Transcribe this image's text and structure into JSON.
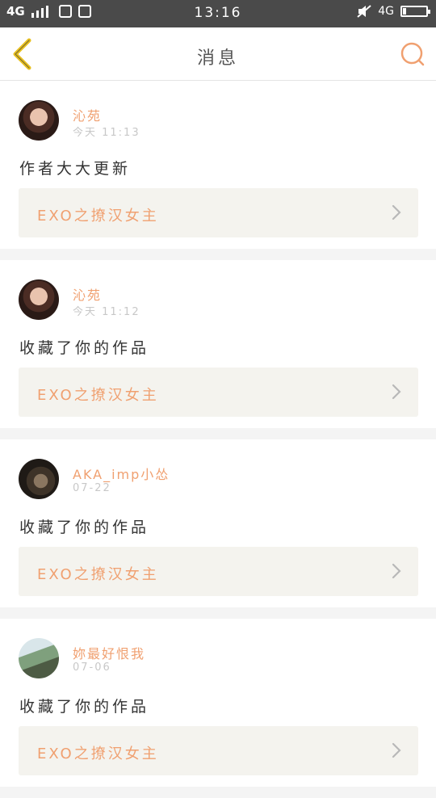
{
  "status_bar": {
    "signal_text": "4G",
    "time": "13:16",
    "network_right": "4G",
    "battery_level": 0.15
  },
  "nav": {
    "title": "消息",
    "back_icon": "chevron-left-icon",
    "search_icon": "search-icon"
  },
  "messages": [
    {
      "user": "沁苑",
      "time": "今天 11:13",
      "text": "作者大大更新",
      "work_title": "EXO之撩汉女主"
    },
    {
      "user": "沁苑",
      "time": "今天 11:12",
      "text": "收藏了你的作品",
      "work_title": "EXO之撩汉女主"
    },
    {
      "user": "AKA_imp小怂",
      "time": "07-22",
      "text": "收藏了你的作品",
      "work_title": "EXO之撩汉女主"
    },
    {
      "user": "妳最好恨我",
      "time": "07-06",
      "text": "收藏了你的作品",
      "work_title": "EXO之撩汉女主"
    }
  ],
  "colors": {
    "accent": "#f0a070",
    "back_icon": "#e8c020",
    "status_bar": "#4a4a4a"
  }
}
